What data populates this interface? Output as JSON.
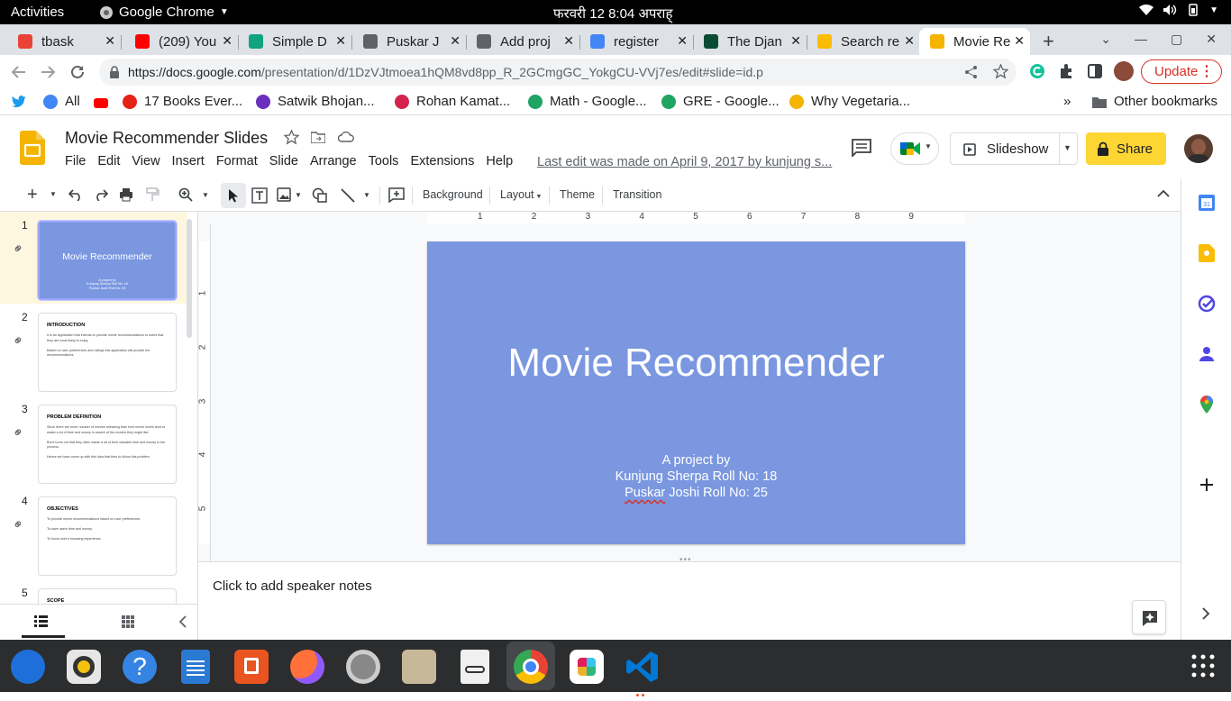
{
  "system_bar": {
    "activities": "Activities",
    "app_name": "Google Chrome",
    "clock": "फरवरी 12   8:04 अपराह्"
  },
  "tabs": [
    {
      "title": "tbask",
      "favicon": "tbask-icon",
      "color": "#ea4335"
    },
    {
      "title": "(209) You",
      "favicon": "youtube-icon",
      "color": "#ff0000"
    },
    {
      "title": "Simple D",
      "favicon": "chatgpt-icon",
      "color": "#10a37f"
    },
    {
      "title": "Puskar J",
      "favicon": "globe-icon",
      "color": "#5f6368"
    },
    {
      "title": "Add proj",
      "favicon": "globe-icon",
      "color": "#5f6368"
    },
    {
      "title": "register",
      "favicon": "google-icon",
      "color": "#4285f4"
    },
    {
      "title": "The Djan",
      "favicon": "django-icon",
      "color": "#0c4b33"
    },
    {
      "title": "Search re",
      "favicon": "drive-icon",
      "color": "#fbbc04"
    },
    {
      "title": "Movie Re",
      "favicon": "slides-icon",
      "color": "#f4b400"
    }
  ],
  "address_bar": {
    "url_host": "https://docs.google.com",
    "url_path": "/presentation/d/1DzVJtmoea1hQM8vd8pp_R_2GCmgGC_YokgCU-VVj7es/edit#slide=id.p",
    "update_label": "Update"
  },
  "bookmarks": [
    {
      "label": "All",
      "icon": "google-icon"
    },
    {
      "label": "17 Books Ever...",
      "icon": "t-icon"
    },
    {
      "label": "Satwik Bhojan...",
      "icon": "m-icon"
    },
    {
      "label": "Rohan Kamat...",
      "icon": "c-icon"
    },
    {
      "label": "Math - Google...",
      "icon": "drive-icon"
    },
    {
      "label": "GRE - Google...",
      "icon": "drive-icon"
    },
    {
      "label": "Why Vegetaria...",
      "icon": "bowl-icon"
    }
  ],
  "bookmarks_overflow": "»",
  "other_bookmarks": "Other bookmarks",
  "slides": {
    "doc_title": "Movie Recommender Slides",
    "menu": [
      "File",
      "Edit",
      "View",
      "Insert",
      "Format",
      "Slide",
      "Arrange",
      "Tools",
      "Extensions",
      "Help"
    ],
    "last_edit": "Last edit was made on April 9, 2017 by kunjung s...",
    "slideshow_label": "Slideshow",
    "share_label": "Share",
    "toolbar": {
      "background": "Background",
      "layout": "Layout",
      "theme": "Theme",
      "transition": "Transition"
    },
    "ruler_numbers": [
      "1",
      "2",
      "3",
      "4",
      "5",
      "6",
      "7",
      "8",
      "9"
    ],
    "vruler_numbers": [
      "1",
      "2",
      "3",
      "4",
      "5"
    ],
    "current_slide": {
      "title": "Movie Recommender",
      "subtitle_line1": "A project by",
      "subtitle_line2": "Kunjung Sherpa Roll No: 18",
      "subtitle_line3_a": "Puskar",
      "subtitle_line3_b": " Joshi Roll No: 25"
    },
    "thumbnails": [
      {
        "num": "1",
        "title": "Movie Recommender",
        "body": "A project by\nKunjung Sherpa Roll No: 18\nPuskar Joshi Roll No: 25"
      },
      {
        "num": "2",
        "title": "INTRODUCTION",
        "body": "It is an application that intends to provide movie recommendations to users that they are most likely to enjoy.\n\nBased on user preferences and ratings this application will provide the recommendations."
      },
      {
        "num": "3",
        "title": "PROBLEM DEFINITION",
        "body": "Since there are more number of movies releasing than ever movie lovers tend to waste a lot of time and money in search of the movies they might like.\n\nBut it turns out that they often waste a lot of their valuable time and money in the process.\n\nHence we have come up with this idea that tries to follow this problem."
      },
      {
        "num": "4",
        "title": "OBJECTIVES",
        "body": "To provide movie recommendations based on user preferences.\n\nTo save users time and money.\n\nTo boost user's browsing experience."
      },
      {
        "num": "5",
        "title": "SCOPE",
        "body": ""
      }
    ],
    "notes_placeholder": "Click to add speaker notes"
  },
  "colors": {
    "slide_bg": "#7a97e0",
    "share_bg": "#fdd634",
    "update_red": "#d93025"
  },
  "dock_apps": [
    "thunderbird-icon",
    "rhythmbox-icon",
    "help-icon",
    "writer-icon",
    "app-center-icon",
    "firefox-icon",
    "settings-icon",
    "files-icon",
    "document-viewer-icon",
    "chrome-icon",
    "slack-icon",
    "vscode-icon",
    "app-grid-icon"
  ]
}
